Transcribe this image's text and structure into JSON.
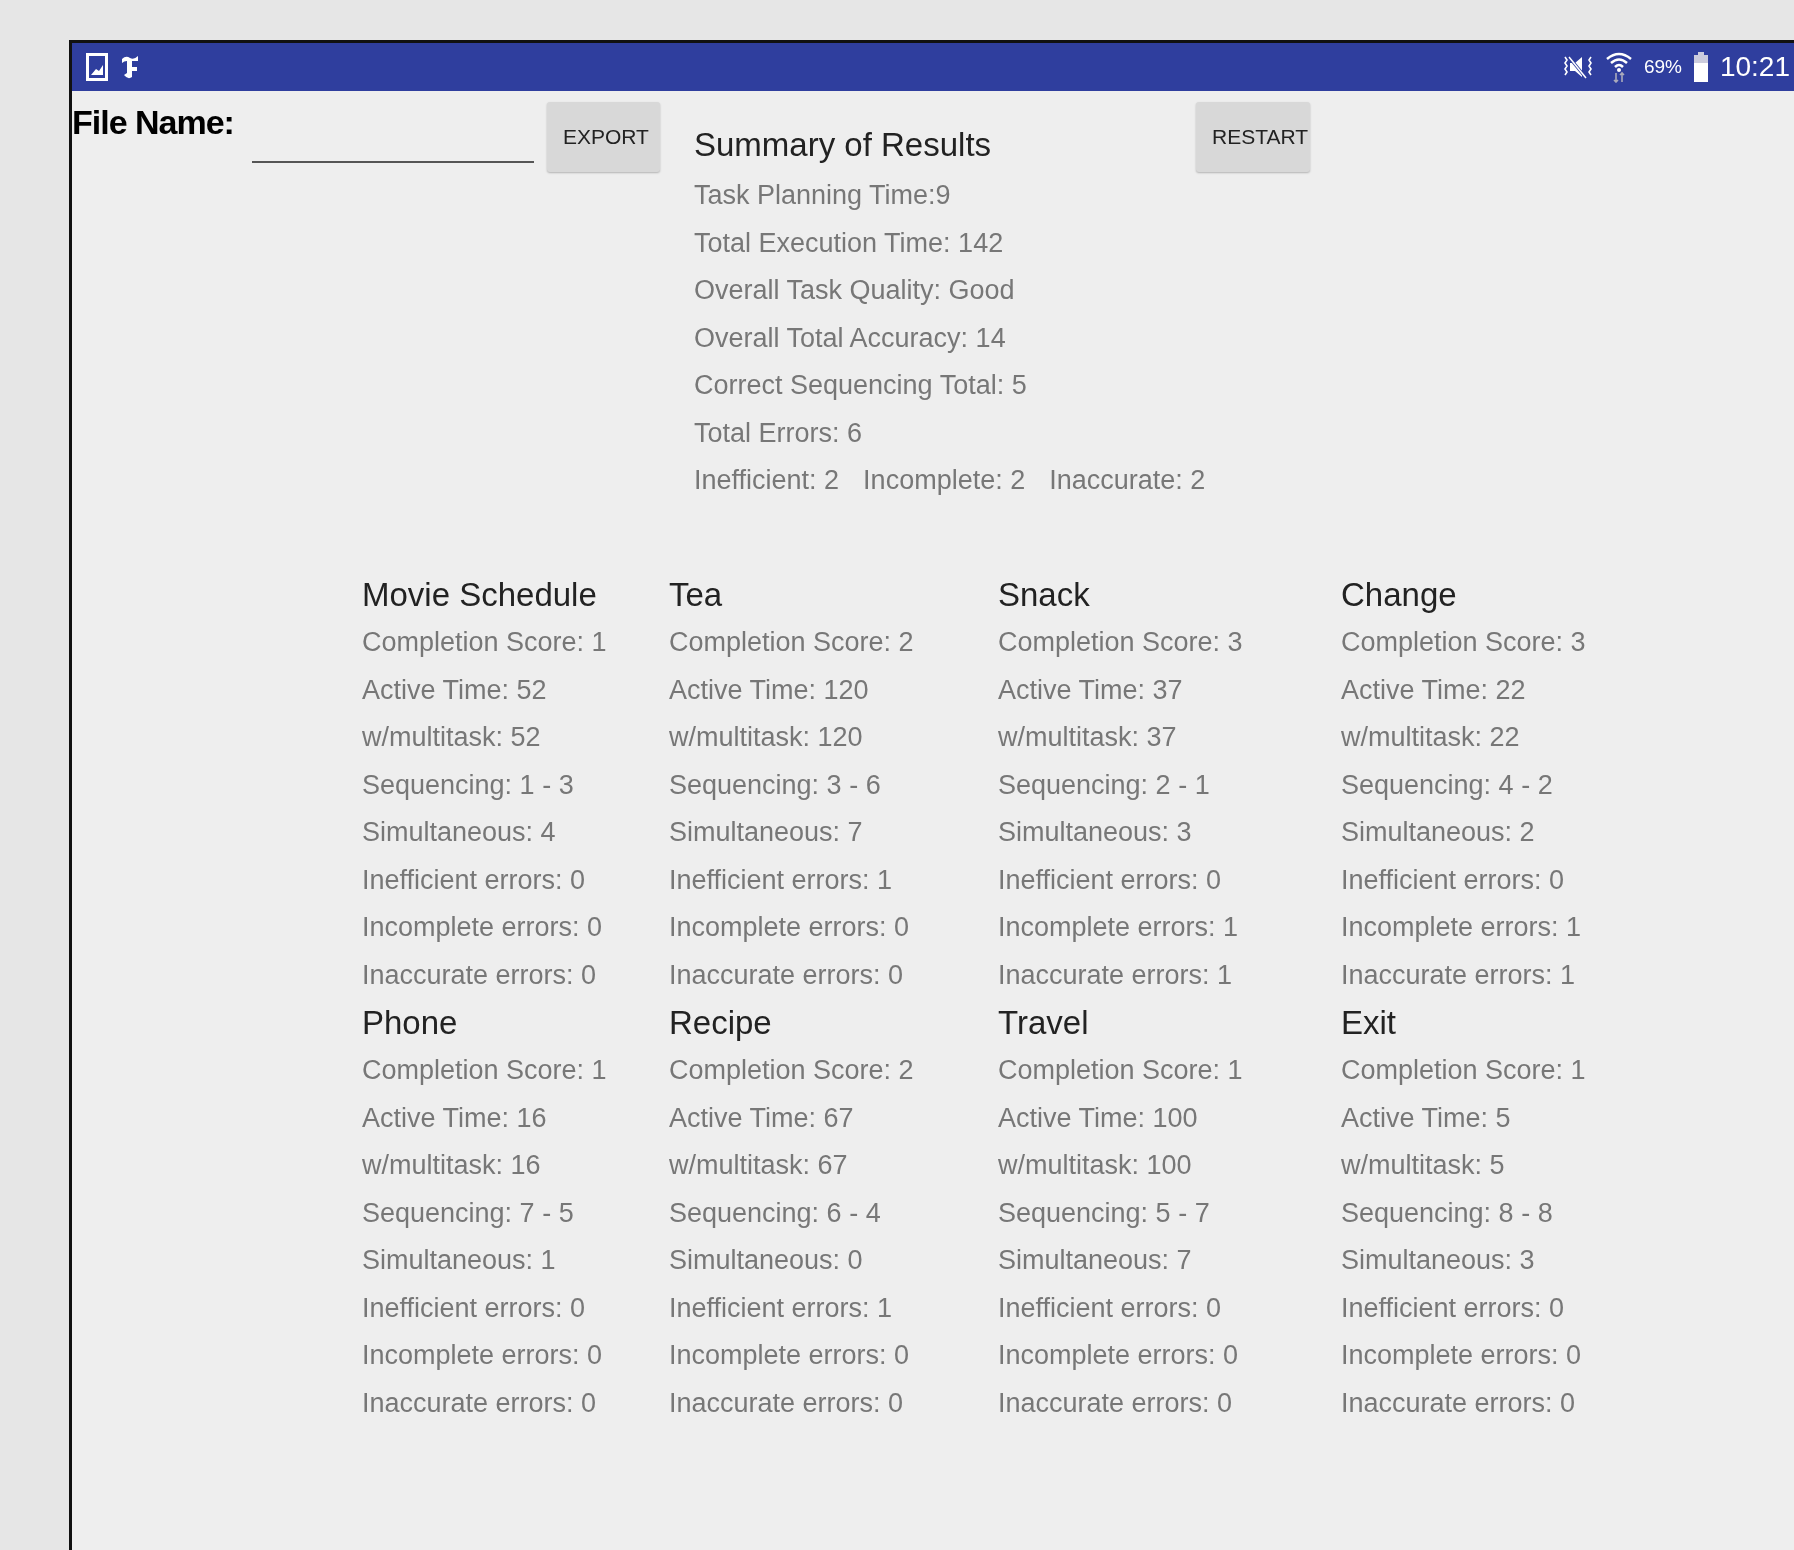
{
  "status_bar": {
    "battery_text": "69%",
    "time": "10:21"
  },
  "file_name": {
    "label": "File Name:"
  },
  "buttons": {
    "export": "EXPORT",
    "restart": "RESTART"
  },
  "summary": {
    "title": "Summary of Results",
    "lines": [
      "Task Planning Time:9",
      "Total Execution Time: 142",
      "Overall Task Quality: Good",
      "Overall Total Accuracy: 14",
      "Correct Sequencing Total: 5",
      "Total Errors: 6"
    ],
    "errors": [
      "Inefficient: 2",
      "Incomplete: 2",
      "Inaccurate: 2"
    ]
  },
  "tasks": [
    {
      "title": "Movie Schedule",
      "lines": [
        "Completion Score: 1",
        "Active Time: 52",
        "w/multitask: 52",
        "Sequencing: 1 - 3",
        "Simultaneous: 4",
        "Inefficient errors: 0",
        "Incomplete errors: 0",
        "Inaccurate errors: 0"
      ]
    },
    {
      "title": "Tea",
      "lines": [
        "Completion Score: 2",
        "Active Time: 120",
        "w/multitask: 120",
        "Sequencing: 3 - 6",
        "Simultaneous: 7",
        "Inefficient errors: 1",
        "Incomplete errors: 0",
        "Inaccurate errors: 0"
      ]
    },
    {
      "title": "Snack",
      "lines": [
        "Completion Score: 3",
        "Active Time: 37",
        "w/multitask: 37",
        "Sequencing: 2 - 1",
        "Simultaneous: 3",
        "Inefficient errors: 0",
        "Incomplete errors: 1",
        "Inaccurate errors: 1"
      ]
    },
    {
      "title": "Change",
      "lines": [
        "Completion Score: 3",
        "Active Time: 22",
        "w/multitask: 22",
        "Sequencing: 4 - 2",
        "Simultaneous: 2",
        "Inefficient errors: 0",
        "Incomplete errors: 1",
        "Inaccurate errors: 1"
      ]
    },
    {
      "title": "Phone",
      "lines": [
        "Completion Score: 1",
        "Active Time: 16",
        "w/multitask: 16",
        "Sequencing: 7 - 5",
        "Simultaneous: 1",
        "Inefficient errors: 0",
        "Incomplete errors: 0",
        "Inaccurate errors: 0"
      ]
    },
    {
      "title": "Recipe",
      "lines": [
        "Completion Score: 2",
        "Active Time: 67",
        "w/multitask: 67",
        "Sequencing: 6 - 4",
        "Simultaneous: 0",
        "Inefficient errors: 1",
        "Incomplete errors: 0",
        "Inaccurate errors: 0"
      ]
    },
    {
      "title": "Travel",
      "lines": [
        "Completion Score: 1",
        "Active Time: 100",
        "w/multitask: 100",
        "Sequencing: 5 - 7",
        "Simultaneous: 7",
        "Inefficient errors: 0",
        "Incomplete errors: 0",
        "Inaccurate errors: 0"
      ]
    },
    {
      "title": "Exit",
      "lines": [
        "Completion Score: 1",
        "Active Time: 5",
        "w/multitask: 5",
        "Sequencing: 8 - 8",
        "Simultaneous: 3",
        "Inefficient errors: 0",
        "Incomplete errors: 0",
        "Inaccurate errors: 0"
      ]
    }
  ]
}
